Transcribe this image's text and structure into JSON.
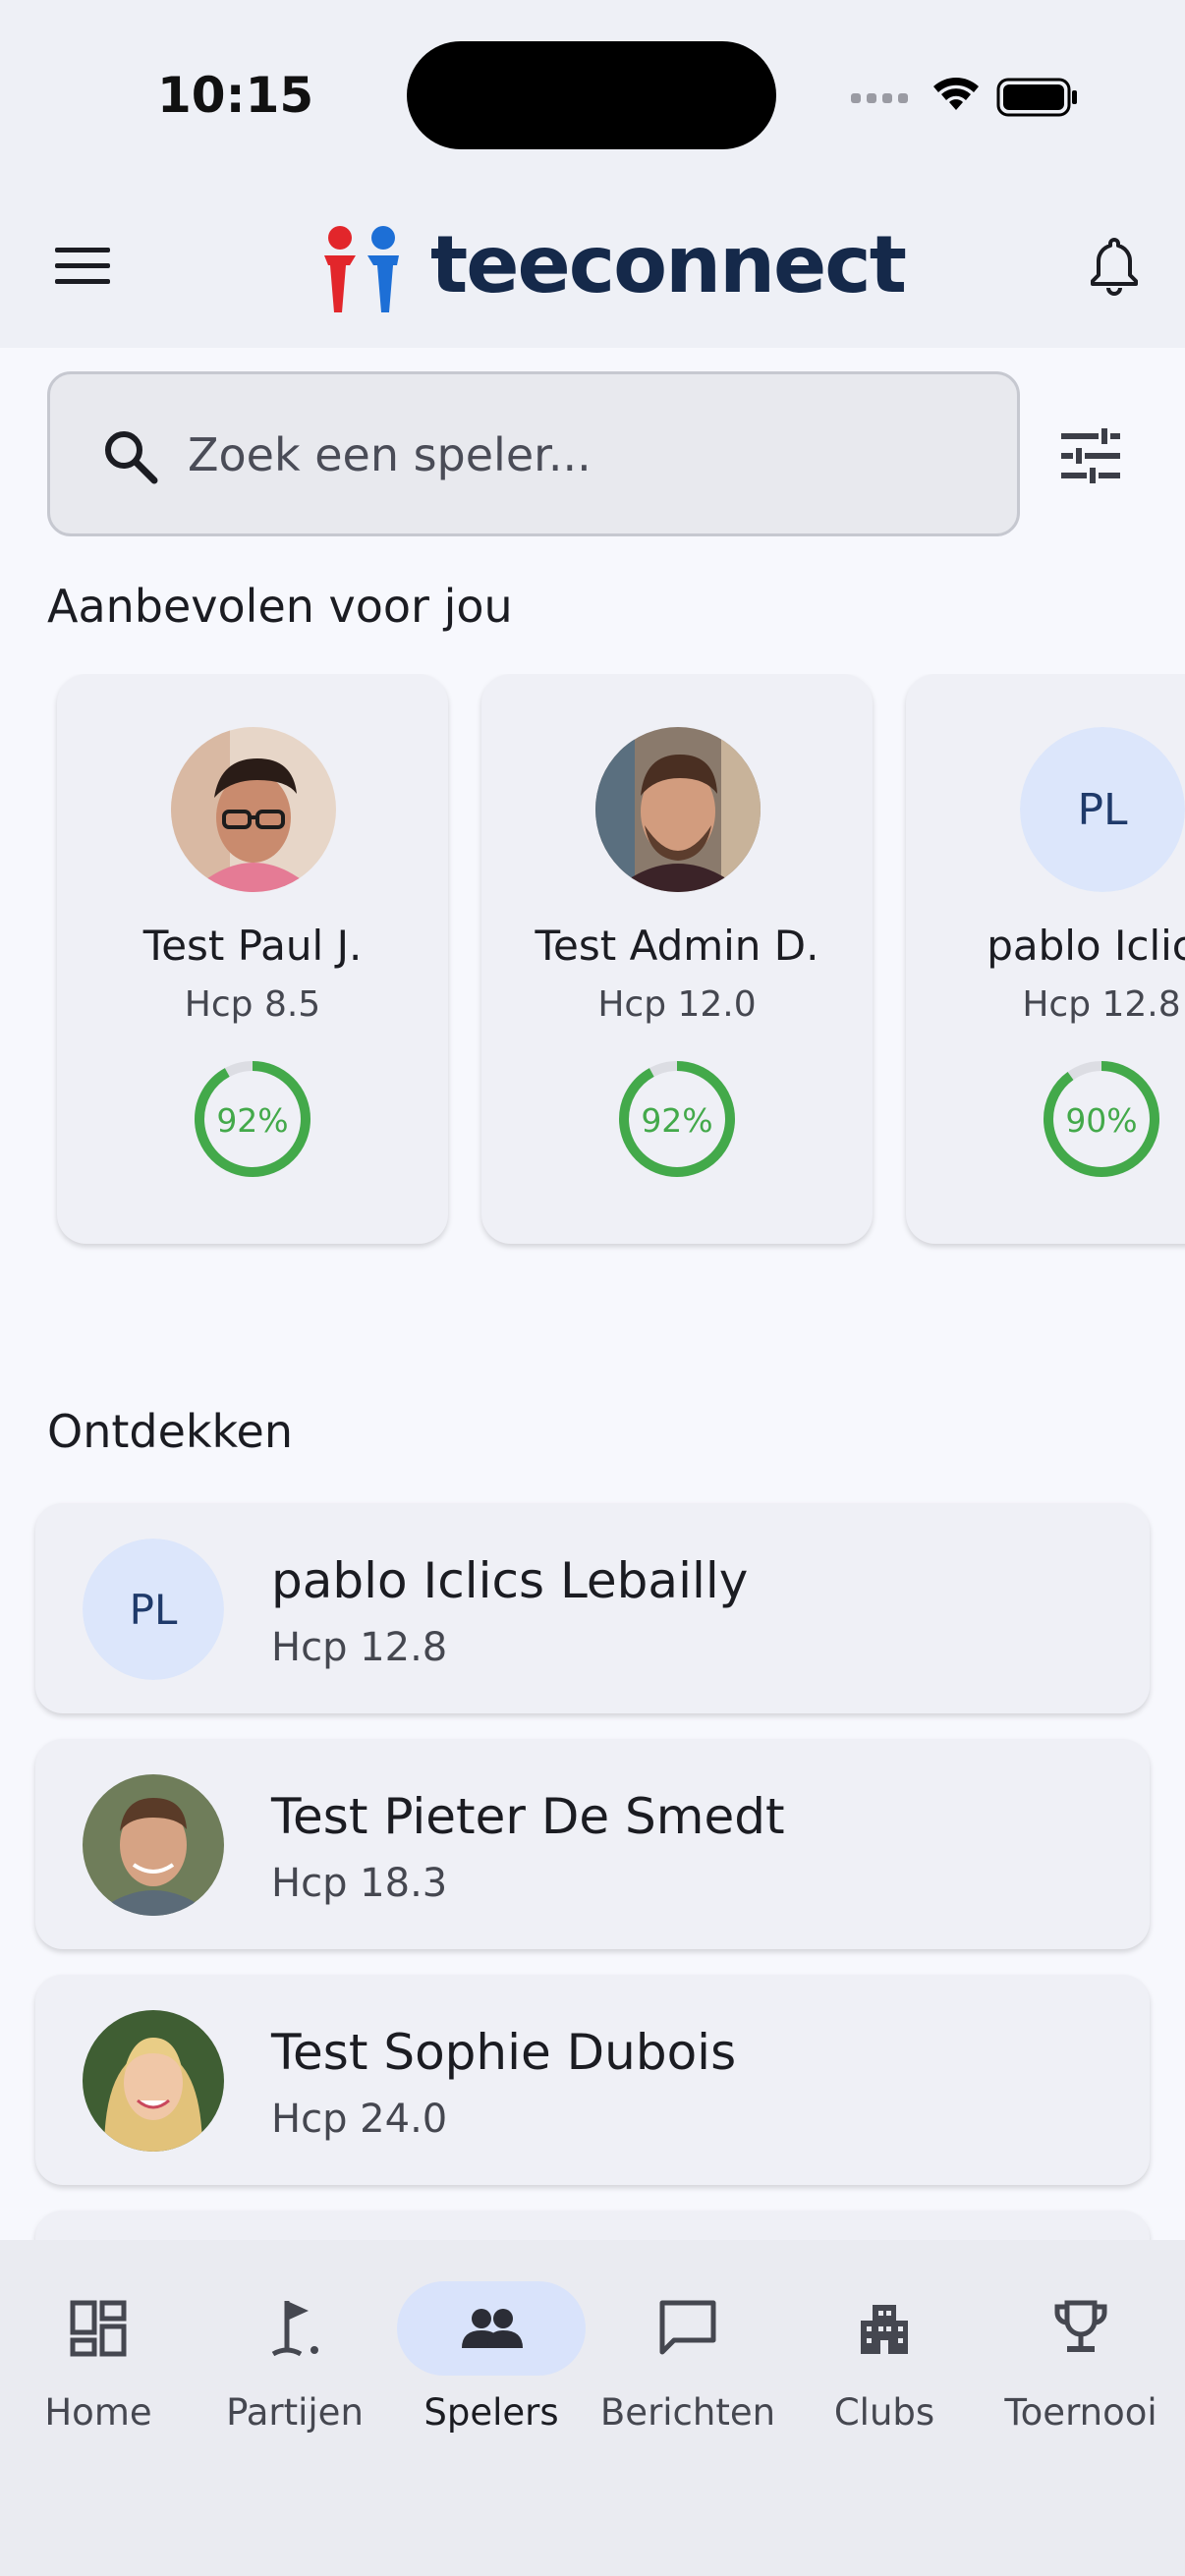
{
  "status_bar": {
    "time": "10:15"
  },
  "header": {
    "brand": "teeconnect"
  },
  "search": {
    "placeholder": "Zoek een speler..."
  },
  "recommended": {
    "title": "Aanbevolen voor jou",
    "cards": [
      {
        "name": "Test Paul J.",
        "hcp": "Hcp 8.5",
        "match": "92%",
        "match_value": 0.92,
        "avatar": "photo"
      },
      {
        "name": "Test Admin D.",
        "hcp": "Hcp 12.0",
        "match": "92%",
        "match_value": 0.92,
        "avatar": "photo"
      },
      {
        "name": "pablo Iclics",
        "hcp": "Hcp 12.8",
        "match": "90%",
        "match_value": 0.9,
        "initials": "PL"
      }
    ]
  },
  "discover": {
    "title": "Ontdekken",
    "items": [
      {
        "name": "pablo Iclics Lebailly",
        "hcp": "Hcp 12.8",
        "initials": "PL"
      },
      {
        "name": "Test Pieter De Smedt",
        "hcp": "Hcp 18.3",
        "avatar": "photo"
      },
      {
        "name": "Test Sophie Dubois",
        "hcp": "Hcp 24.0",
        "avatar": "photo"
      }
    ]
  },
  "bottom_nav": {
    "items": [
      {
        "label": "Home",
        "icon": "dashboard-icon"
      },
      {
        "label": "Partijen",
        "icon": "golf-flag-icon"
      },
      {
        "label": "Spelers",
        "icon": "people-icon",
        "active": true
      },
      {
        "label": "Berichten",
        "icon": "chat-icon"
      },
      {
        "label": "Clubs",
        "icon": "building-icon"
      },
      {
        "label": "Toernooi",
        "icon": "trophy-icon"
      }
    ]
  },
  "colors": {
    "brand_navy": "#15294a",
    "brand_red": "#e2262b",
    "brand_blue": "#1d6fd6",
    "ring_green": "#43a94a",
    "nav_active": "#d9e3fb",
    "initials_bg": "#dce6fb"
  }
}
